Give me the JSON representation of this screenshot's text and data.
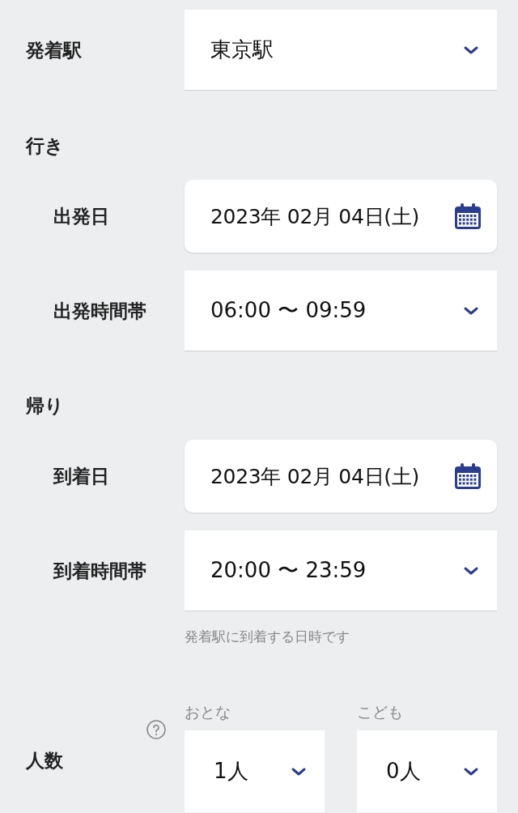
{
  "station": {
    "label": "発着駅",
    "value": "東京駅"
  },
  "sections": [
    {
      "heading": "行き",
      "fields": [
        {
          "kind": "date",
          "label": "出発日",
          "value": "2023年 02月 04日(土)"
        },
        {
          "kind": "select",
          "label": "出発時間帯",
          "value": "06:00 〜 09:59"
        }
      ]
    },
    {
      "heading": "帰り",
      "fields": [
        {
          "kind": "date",
          "label": "到着日",
          "value": "2023年 02月 04日(土)"
        },
        {
          "kind": "select",
          "label": "到着時間帯",
          "value": "20:00 〜 23:59"
        }
      ],
      "note": "発着駅に到着する日時です"
    }
  ],
  "party": {
    "label": "人数",
    "counts": [
      {
        "label": "おとな",
        "value": "1人"
      },
      {
        "label": "こども",
        "value": "0人"
      }
    ]
  }
}
